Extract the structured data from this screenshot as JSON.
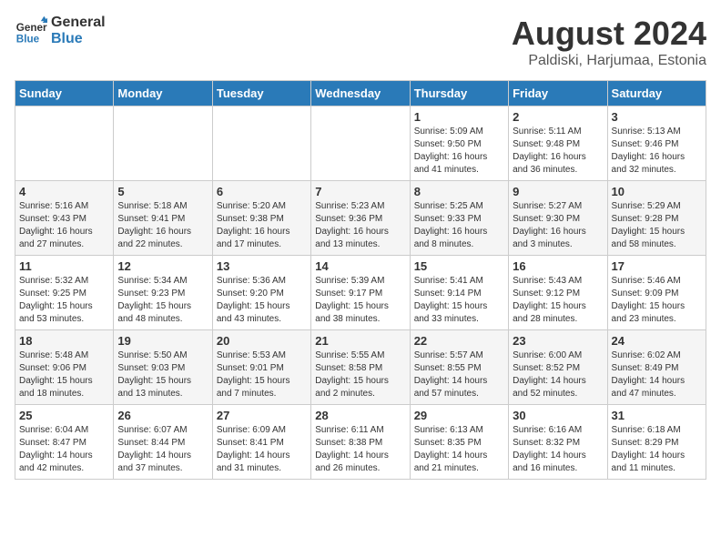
{
  "header": {
    "logo_general": "General",
    "logo_blue": "Blue",
    "month_year": "August 2024",
    "location": "Paldiski, Harjumaa, Estonia"
  },
  "weekdays": [
    "Sunday",
    "Monday",
    "Tuesday",
    "Wednesday",
    "Thursday",
    "Friday",
    "Saturday"
  ],
  "weeks": [
    [
      {
        "day": "",
        "info": ""
      },
      {
        "day": "",
        "info": ""
      },
      {
        "day": "",
        "info": ""
      },
      {
        "day": "",
        "info": ""
      },
      {
        "day": "1",
        "info": "Sunrise: 5:09 AM\nSunset: 9:50 PM\nDaylight: 16 hours\nand 41 minutes."
      },
      {
        "day": "2",
        "info": "Sunrise: 5:11 AM\nSunset: 9:48 PM\nDaylight: 16 hours\nand 36 minutes."
      },
      {
        "day": "3",
        "info": "Sunrise: 5:13 AM\nSunset: 9:46 PM\nDaylight: 16 hours\nand 32 minutes."
      }
    ],
    [
      {
        "day": "4",
        "info": "Sunrise: 5:16 AM\nSunset: 9:43 PM\nDaylight: 16 hours\nand 27 minutes."
      },
      {
        "day": "5",
        "info": "Sunrise: 5:18 AM\nSunset: 9:41 PM\nDaylight: 16 hours\nand 22 minutes."
      },
      {
        "day": "6",
        "info": "Sunrise: 5:20 AM\nSunset: 9:38 PM\nDaylight: 16 hours\nand 17 minutes."
      },
      {
        "day": "7",
        "info": "Sunrise: 5:23 AM\nSunset: 9:36 PM\nDaylight: 16 hours\nand 13 minutes."
      },
      {
        "day": "8",
        "info": "Sunrise: 5:25 AM\nSunset: 9:33 PM\nDaylight: 16 hours\nand 8 minutes."
      },
      {
        "day": "9",
        "info": "Sunrise: 5:27 AM\nSunset: 9:30 PM\nDaylight: 16 hours\nand 3 minutes."
      },
      {
        "day": "10",
        "info": "Sunrise: 5:29 AM\nSunset: 9:28 PM\nDaylight: 15 hours\nand 58 minutes."
      }
    ],
    [
      {
        "day": "11",
        "info": "Sunrise: 5:32 AM\nSunset: 9:25 PM\nDaylight: 15 hours\nand 53 minutes."
      },
      {
        "day": "12",
        "info": "Sunrise: 5:34 AM\nSunset: 9:23 PM\nDaylight: 15 hours\nand 48 minutes."
      },
      {
        "day": "13",
        "info": "Sunrise: 5:36 AM\nSunset: 9:20 PM\nDaylight: 15 hours\nand 43 minutes."
      },
      {
        "day": "14",
        "info": "Sunrise: 5:39 AM\nSunset: 9:17 PM\nDaylight: 15 hours\nand 38 minutes."
      },
      {
        "day": "15",
        "info": "Sunrise: 5:41 AM\nSunset: 9:14 PM\nDaylight: 15 hours\nand 33 minutes."
      },
      {
        "day": "16",
        "info": "Sunrise: 5:43 AM\nSunset: 9:12 PM\nDaylight: 15 hours\nand 28 minutes."
      },
      {
        "day": "17",
        "info": "Sunrise: 5:46 AM\nSunset: 9:09 PM\nDaylight: 15 hours\nand 23 minutes."
      }
    ],
    [
      {
        "day": "18",
        "info": "Sunrise: 5:48 AM\nSunset: 9:06 PM\nDaylight: 15 hours\nand 18 minutes."
      },
      {
        "day": "19",
        "info": "Sunrise: 5:50 AM\nSunset: 9:03 PM\nDaylight: 15 hours\nand 13 minutes."
      },
      {
        "day": "20",
        "info": "Sunrise: 5:53 AM\nSunset: 9:01 PM\nDaylight: 15 hours\nand 7 minutes."
      },
      {
        "day": "21",
        "info": "Sunrise: 5:55 AM\nSunset: 8:58 PM\nDaylight: 15 hours\nand 2 minutes."
      },
      {
        "day": "22",
        "info": "Sunrise: 5:57 AM\nSunset: 8:55 PM\nDaylight: 14 hours\nand 57 minutes."
      },
      {
        "day": "23",
        "info": "Sunrise: 6:00 AM\nSunset: 8:52 PM\nDaylight: 14 hours\nand 52 minutes."
      },
      {
        "day": "24",
        "info": "Sunrise: 6:02 AM\nSunset: 8:49 PM\nDaylight: 14 hours\nand 47 minutes."
      }
    ],
    [
      {
        "day": "25",
        "info": "Sunrise: 6:04 AM\nSunset: 8:47 PM\nDaylight: 14 hours\nand 42 minutes."
      },
      {
        "day": "26",
        "info": "Sunrise: 6:07 AM\nSunset: 8:44 PM\nDaylight: 14 hours\nand 37 minutes."
      },
      {
        "day": "27",
        "info": "Sunrise: 6:09 AM\nSunset: 8:41 PM\nDaylight: 14 hours\nand 31 minutes."
      },
      {
        "day": "28",
        "info": "Sunrise: 6:11 AM\nSunset: 8:38 PM\nDaylight: 14 hours\nand 26 minutes."
      },
      {
        "day": "29",
        "info": "Sunrise: 6:13 AM\nSunset: 8:35 PM\nDaylight: 14 hours\nand 21 minutes."
      },
      {
        "day": "30",
        "info": "Sunrise: 6:16 AM\nSunset: 8:32 PM\nDaylight: 14 hours\nand 16 minutes."
      },
      {
        "day": "31",
        "info": "Sunrise: 6:18 AM\nSunset: 8:29 PM\nDaylight: 14 hours\nand 11 minutes."
      }
    ]
  ]
}
